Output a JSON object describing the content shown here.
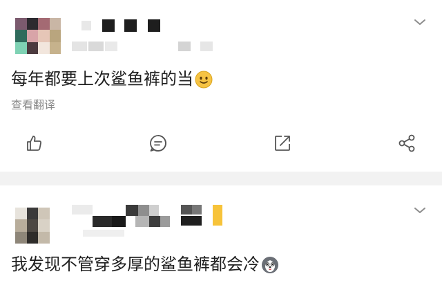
{
  "posts": [
    {
      "text": "每年都要上次鲨鱼裤的当",
      "emoji_icon": "smiley-face-icon",
      "translate_label": "查看翻译",
      "actions": [
        {
          "icon": "thumbs-up-icon"
        },
        {
          "icon": "comment-icon"
        },
        {
          "icon": "repost-icon"
        },
        {
          "icon": "share-icon"
        }
      ]
    },
    {
      "text": "我发现不管穿多厚的鲨鱼裤都会冷",
      "emoji_icon": "husky-face-icon"
    }
  ],
  "colors": {
    "text": "#1f1f1f",
    "secondary_text": "#8a8a8a",
    "icon": "#555555",
    "divider": "#f2f2f2",
    "emoji_yellow": "#f6c343",
    "accent_yellow": "#f7c33a"
  }
}
